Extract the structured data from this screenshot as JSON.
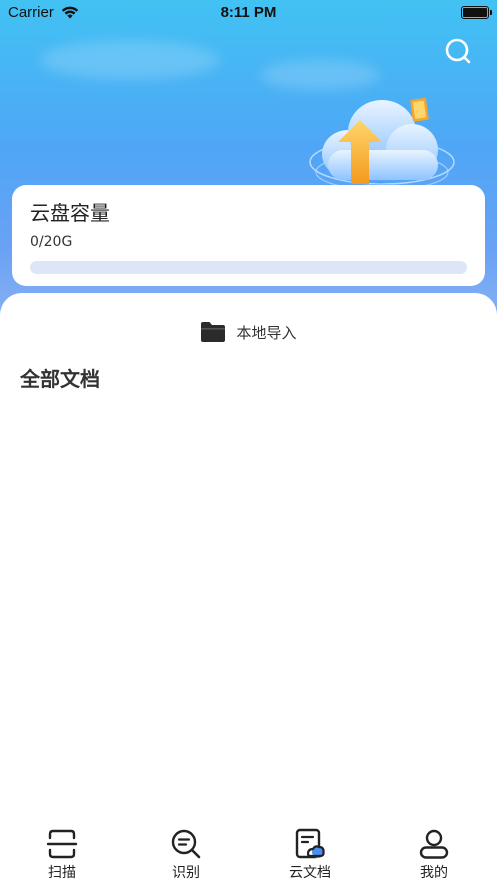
{
  "status_bar": {
    "carrier": "Carrier",
    "time": "8:11 PM"
  },
  "storage": {
    "title": "云盘容量",
    "usage": "0/20G",
    "used_fraction": 0
  },
  "actions": {
    "local_import": "本地导入"
  },
  "documents": {
    "section_title": "全部文档",
    "items": []
  },
  "tabbar": {
    "active_index": 2,
    "tabs": [
      {
        "label": "扫描",
        "icon": "scan-icon"
      },
      {
        "label": "识别",
        "icon": "recognize-icon"
      },
      {
        "label": "云文档",
        "icon": "cloud-document-icon"
      },
      {
        "label": "我的",
        "icon": "profile-icon"
      }
    ]
  },
  "colors": {
    "accent": "#4a8ef5",
    "hero_top": "#41c2f3",
    "hero_bottom": "#8ab3f2"
  }
}
